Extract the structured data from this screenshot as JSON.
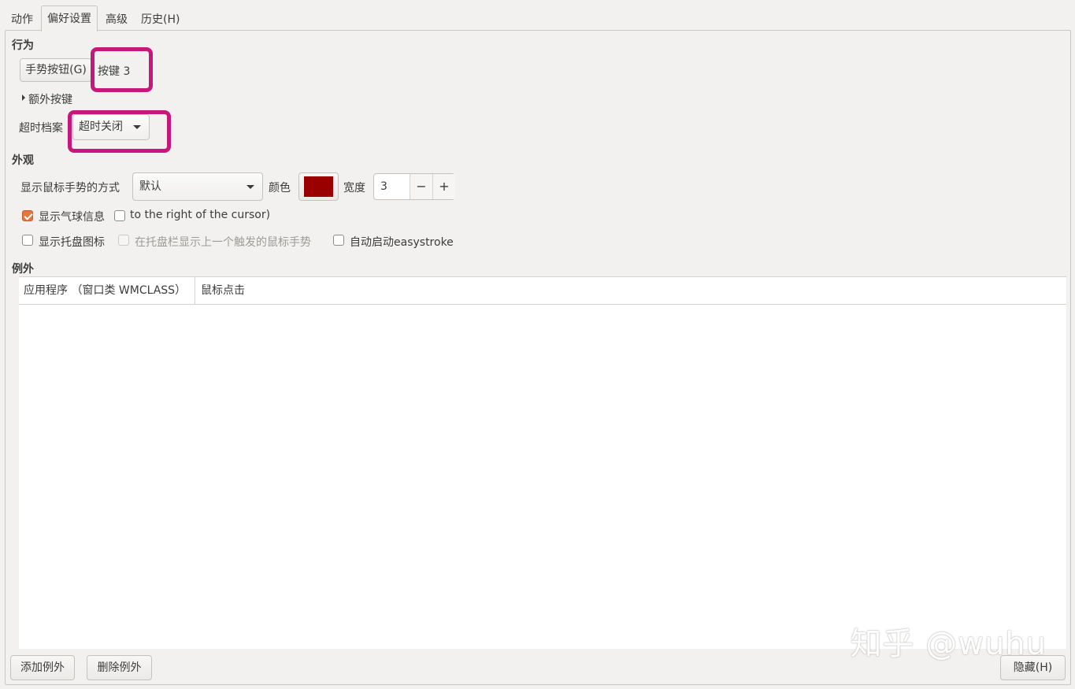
{
  "tabs": [
    {
      "label": "动作",
      "active": false
    },
    {
      "label": "偏好设置",
      "active": true
    },
    {
      "label": "高级",
      "active": false
    },
    {
      "label": "历史(H)",
      "active": false
    }
  ],
  "behavior": {
    "title": "行为",
    "gesture_button_label": "手势按钮(G)",
    "gesture_button_value": "按键 3",
    "extra_buttons_label": "额外按键",
    "timeout_label": "超时档案",
    "timeout_value": "超时关闭"
  },
  "appearance": {
    "title": "外观",
    "show_gesture_label": "显示鼠标手势的方式",
    "show_gesture_value": "默认",
    "color_label": "颜色",
    "color_value": "#9a0000",
    "width_label": "宽度",
    "width_value": "3",
    "minus": "−",
    "plus": "+",
    "show_balloon_label": "显示气球信息",
    "show_balloon_checked": true,
    "right_of_cursor_label": "to the right of the cursor)",
    "right_of_cursor_checked": false,
    "show_tray_label": "显示托盘图标",
    "show_tray_checked": false,
    "tray_last_gesture_label": "在托盘栏显示上一个触发的鼠标手势",
    "tray_last_gesture_checked": false,
    "autostart_label": "自动启动easystroke",
    "autostart_checked": false
  },
  "exceptions": {
    "title": "例外",
    "columns": [
      "应用程序 （窗口类 WMCLASS）",
      "鼠标点击"
    ],
    "rows": []
  },
  "footer": {
    "add_label": "添加例外",
    "remove_label": "删除例外",
    "hide_label": "隐藏(H)"
  },
  "watermark": "知乎 @wuhu",
  "colors": {
    "highlight": "#c6187a",
    "accent": "#e4773f"
  }
}
